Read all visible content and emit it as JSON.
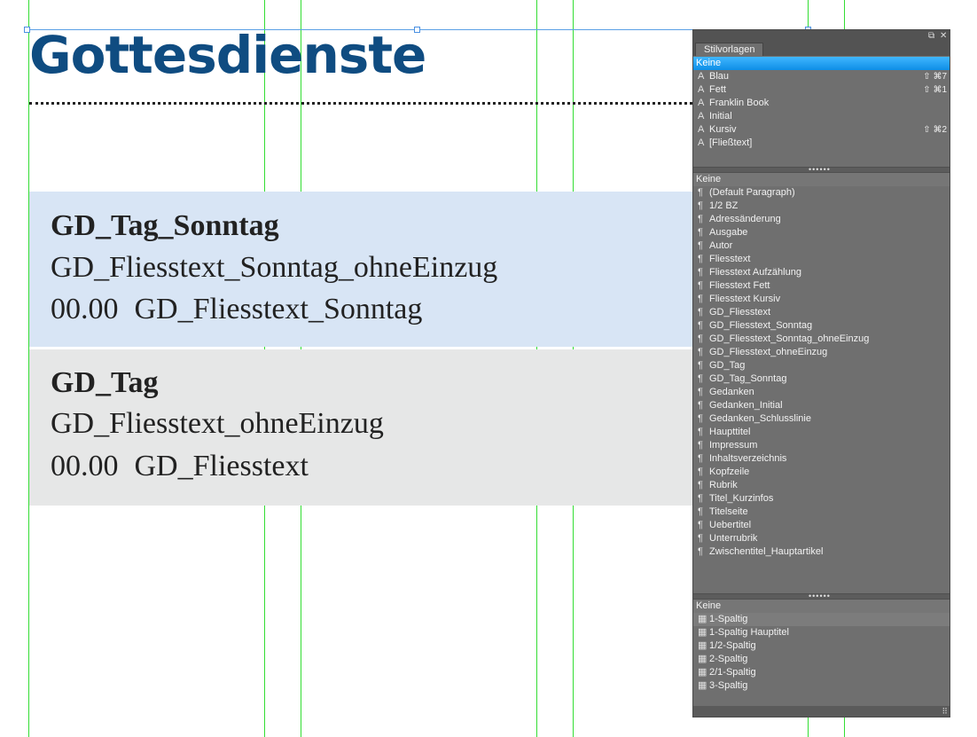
{
  "document": {
    "title": "Gottesdienste",
    "sunday_block": {
      "heading": "GD_Tag_Sonntag",
      "line1": "GD_Fliesstext_Sonntag_ohneEinzug",
      "line2_number": "00.00",
      "line2_text": "GD_Fliesstext_Sonntag"
    },
    "weekday_block": {
      "heading": "GD_Tag",
      "line1": "GD_Fliesstext_ohneEinzug",
      "line2_number": "00.00",
      "line2_text": "GD_Fliesstext"
    }
  },
  "panel": {
    "tab_label": "Stilvorlagen",
    "char_styles": {
      "header": "Keine",
      "items": [
        {
          "label": "Blau",
          "shortcut": "⇧ ⌘7"
        },
        {
          "label": "Fett",
          "shortcut": "⇧ ⌘1"
        },
        {
          "label": "Franklin Book",
          "shortcut": ""
        },
        {
          "label": "Initial",
          "shortcut": ""
        },
        {
          "label": "Kursiv",
          "shortcut": "⇧ ⌘2"
        },
        {
          "label": "[Fließtext]",
          "shortcut": ""
        }
      ]
    },
    "para_styles": {
      "header": "Keine",
      "items": [
        "(Default Paragraph)",
        "1/2 BZ",
        "Adressänderung",
        "Ausgabe",
        "Autor",
        "Fliesstext",
        "Fliesstext Aufzählung",
        "Fliesstext Fett",
        "Fliesstext Kursiv",
        "GD_Fliesstext",
        "GD_Fliesstext_Sonntag",
        "GD_Fliesstext_Sonntag_ohneEinzug",
        "GD_Fliesstext_ohneEinzug",
        "GD_Tag",
        "GD_Tag_Sonntag",
        "Gedanken",
        "Gedanken_Initial",
        "Gedanken_Schlusslinie",
        "Haupttitel",
        "Impressum",
        "Inhaltsverzeichnis",
        "Kopfzeile",
        "Rubrik",
        "Titel_Kurzinfos",
        "Titelseite",
        "Uebertitel",
        "Unterrubrik",
        "Zwischentitel_Hauptartikel"
      ]
    },
    "object_styles": {
      "header": "Keine",
      "items": [
        "1-Spaltig",
        "1-Spaltig Hauptitel",
        "1/2-Spaltig",
        "2-Spaltig",
        "2/1-Spaltig",
        "3-Spaltig"
      ]
    }
  }
}
